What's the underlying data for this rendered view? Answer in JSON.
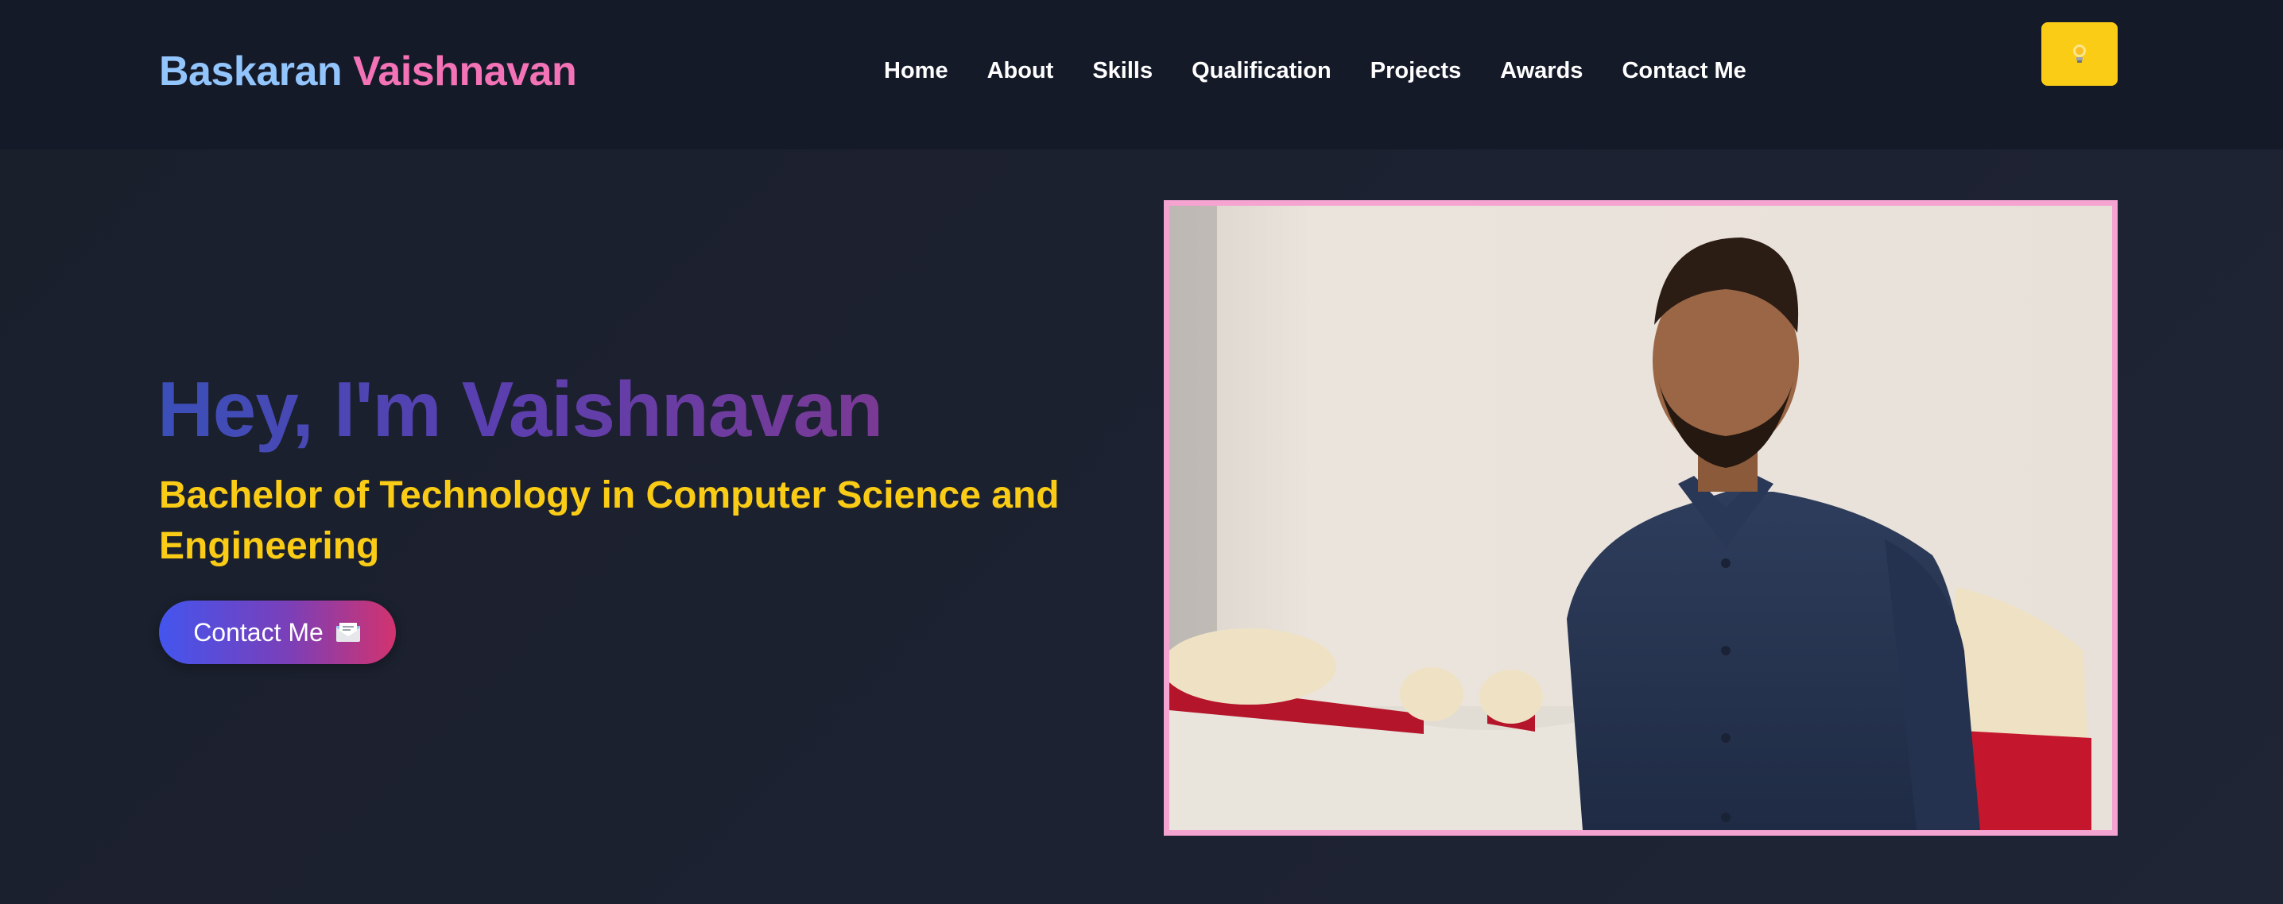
{
  "header": {
    "brand_first": "Baskaran",
    "brand_last": "Vaishnavan",
    "nav_items": [
      "Home",
      "About",
      "Skills",
      "Qualification",
      "Projects",
      "Awards",
      "Contact Me"
    ],
    "theme_toggle_icon": "lightbulb-icon"
  },
  "hero": {
    "title": "Hey, I'm Vaishnavan",
    "subtitle": "Bachelor of Technology in Computer Science and Engineering",
    "cta_label": "Contact Me",
    "cta_icon": "envelope-icon",
    "photo_icon": "profile-photo"
  },
  "colors": {
    "brand_first": "#93c5fd",
    "brand_last": "#f472b6",
    "subtitle": "#facc15",
    "toggle_bg": "#facc15",
    "photo_border": "#f5a3d0"
  }
}
